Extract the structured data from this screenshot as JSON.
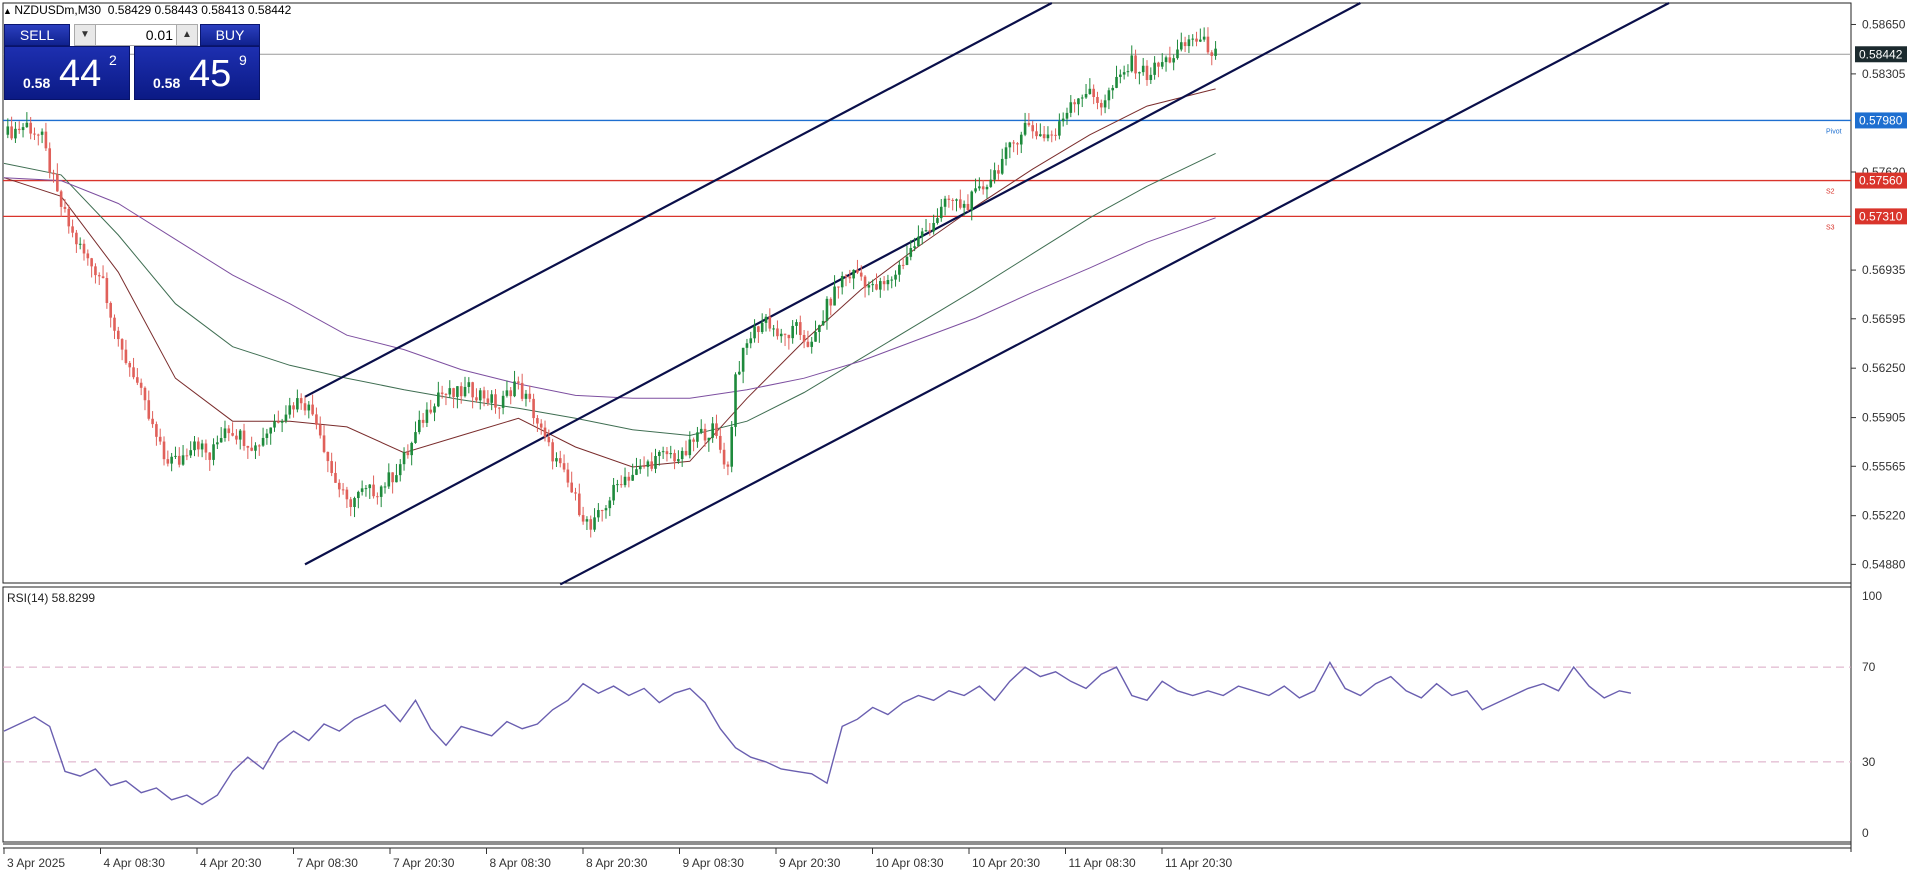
{
  "header": {
    "symbol": "NZDUSDm,M30",
    "ohlc": "0.58429 0.58443 0.58413 0.58442"
  },
  "trade_panel": {
    "sell_label": "SELL",
    "buy_label": "BUY",
    "lot_value": "0.01",
    "sell_prefix": "0.58",
    "sell_big": "44",
    "sell_sup": "2",
    "buy_prefix": "0.58",
    "buy_big": "45",
    "buy_sup": "9"
  },
  "chart_data": [
    {
      "type": "candlestick",
      "symbol": "NZDUSDm",
      "timeframe": "M30",
      "y_ticks": [
        "0.58650",
        "0.58305",
        "0.57620",
        "0.56935",
        "0.56595",
        "0.56250",
        "0.55905",
        "0.55565",
        "0.55220",
        "0.54880"
      ],
      "ylim": [
        0.5475,
        0.588
      ],
      "x_ticks": [
        "3 Apr 2025",
        "4 Apr 08:30",
        "4 Apr 20:30",
        "7 Apr 08:30",
        "7 Apr 20:30",
        "8 Apr 08:30",
        "8 Apr 20:30",
        "9 Apr 08:30",
        "9 Apr 20:30",
        "10 Apr 08:30",
        "10 Apr 20:30",
        "11 Apr 08:30",
        "11 Apr 20:30"
      ],
      "current_price": "0.58442",
      "horizontal_levels": [
        {
          "label": "Pivot",
          "price": "0.57980",
          "color": "#1e6fd0"
        },
        {
          "label": "S2",
          "price": "0.57560",
          "color": "#d9342b"
        },
        {
          "label": "S3",
          "price": "0.57310",
          "color": "#d9342b"
        }
      ],
      "close_path": [
        [
          0,
          0.5788
        ],
        [
          6,
          0.5795
        ],
        [
          10,
          0.5785
        ],
        [
          14,
          0.5745
        ],
        [
          18,
          0.5718
        ],
        [
          22,
          0.57
        ],
        [
          26,
          0.5688
        ],
        [
          30,
          0.564
        ],
        [
          34,
          0.5622
        ],
        [
          38,
          0.559
        ],
        [
          42,
          0.5562
        ],
        [
          46,
          0.556
        ],
        [
          50,
          0.5576
        ],
        [
          54,
          0.5562
        ],
        [
          58,
          0.5585
        ],
        [
          62,
          0.5578
        ],
        [
          66,
          0.557
        ],
        [
          70,
          0.5585
        ],
        [
          74,
          0.5596
        ],
        [
          78,
          0.5604
        ],
        [
          82,
          0.559
        ],
        [
          86,
          0.5552
        ],
        [
          90,
          0.553
        ],
        [
          94,
          0.5538
        ],
        [
          98,
          0.554
        ],
        [
          102,
          0.555
        ],
        [
          106,
          0.5566
        ],
        [
          110,
          0.559
        ],
        [
          114,
          0.5608
        ],
        [
          118,
          0.5606
        ],
        [
          122,
          0.561
        ],
        [
          126,
          0.5606
        ],
        [
          130,
          0.5598
        ],
        [
          134,
          0.5615
        ],
        [
          138,
          0.56
        ],
        [
          142,
          0.5574
        ],
        [
          146,
          0.5555
        ],
        [
          150,
          0.5533
        ],
        [
          154,
          0.5512
        ],
        [
          158,
          0.553
        ],
        [
          162,
          0.5548
        ],
        [
          166,
          0.5552
        ],
        [
          170,
          0.556
        ],
        [
          174,
          0.5565
        ],
        [
          178,
          0.5562
        ],
        [
          182,
          0.5578
        ],
        [
          186,
          0.5582
        ],
        [
          190,
          0.5555
        ],
        [
          192,
          0.562
        ],
        [
          196,
          0.5648
        ],
        [
          200,
          0.566
        ],
        [
          204,
          0.5645
        ],
        [
          208,
          0.5652
        ],
        [
          212,
          0.564
        ],
        [
          216,
          0.5668
        ],
        [
          220,
          0.5688
        ],
        [
          224,
          0.5692
        ],
        [
          228,
          0.568
        ],
        [
          232,
          0.5684
        ],
        [
          236,
          0.57
        ],
        [
          240,
          0.5715
        ],
        [
          244,
          0.5728
        ],
        [
          248,
          0.5742
        ],
        [
          252,
          0.5738
        ],
        [
          256,
          0.5748
        ],
        [
          260,
          0.5762
        ],
        [
          264,
          0.5778
        ],
        [
          268,
          0.5795
        ],
        [
          272,
          0.5788
        ],
        [
          276,
          0.5788
        ],
        [
          280,
          0.5812
        ],
        [
          284,
          0.5818
        ],
        [
          288,
          0.581
        ],
        [
          292,
          0.5824
        ],
        [
          296,
          0.5838
        ],
        [
          300,
          0.583
        ],
        [
          304,
          0.5838
        ],
        [
          308,
          0.5845
        ],
        [
          312,
          0.5856
        ],
        [
          316,
          0.585
        ],
        [
          318,
          0.5844
        ]
      ],
      "moving_averages": [
        {
          "color": "#7a2c2c",
          "points": [
            [
              0,
              0.5758
            ],
            [
              15,
              0.5745
            ],
            [
              30,
              0.5692
            ],
            [
              45,
              0.5618
            ],
            [
              60,
              0.5588
            ],
            [
              75,
              0.5588
            ],
            [
              90,
              0.5584
            ],
            [
              105,
              0.5566
            ],
            [
              120,
              0.5578
            ],
            [
              135,
              0.559
            ],
            [
              150,
              0.557
            ],
            [
              165,
              0.5556
            ],
            [
              180,
              0.556
            ],
            [
              195,
              0.5604
            ],
            [
              210,
              0.5644
            ],
            [
              225,
              0.568
            ],
            [
              240,
              0.571
            ],
            [
              255,
              0.5738
            ],
            [
              270,
              0.5764
            ],
            [
              285,
              0.5788
            ],
            [
              300,
              0.5808
            ],
            [
              318,
              0.582
            ]
          ]
        },
        {
          "color": "#3f6e52",
          "points": [
            [
              0,
              0.5768
            ],
            [
              15,
              0.576
            ],
            [
              30,
              0.5718
            ],
            [
              45,
              0.567
            ],
            [
              60,
              0.564
            ],
            [
              75,
              0.5627
            ],
            [
              90,
              0.5618
            ],
            [
              105,
              0.561
            ],
            [
              120,
              0.5603
            ],
            [
              135,
              0.5597
            ],
            [
              150,
              0.559
            ],
            [
              165,
              0.5582
            ],
            [
              180,
              0.5578
            ],
            [
              195,
              0.5588
            ],
            [
              210,
              0.5608
            ],
            [
              225,
              0.5632
            ],
            [
              240,
              0.5656
            ],
            [
              255,
              0.568
            ],
            [
              270,
              0.5705
            ],
            [
              285,
              0.573
            ],
            [
              300,
              0.5752
            ],
            [
              318,
              0.5775
            ]
          ]
        },
        {
          "color": "#7d4fa0",
          "points": [
            [
              0,
              0.5758
            ],
            [
              15,
              0.5756
            ],
            [
              30,
              0.574
            ],
            [
              45,
              0.5715
            ],
            [
              60,
              0.569
            ],
            [
              75,
              0.567
            ],
            [
              90,
              0.5648
            ],
            [
              105,
              0.5638
            ],
            [
              120,
              0.5624
            ],
            [
              135,
              0.5614
            ],
            [
              150,
              0.5606
            ],
            [
              165,
              0.5604
            ],
            [
              180,
              0.5604
            ],
            [
              195,
              0.561
            ],
            [
              210,
              0.5618
            ],
            [
              225,
              0.563
            ],
            [
              240,
              0.5645
            ],
            [
              255,
              0.566
            ],
            [
              270,
              0.5678
            ],
            [
              285,
              0.5695
            ],
            [
              300,
              0.5713
            ],
            [
              318,
              0.573
            ]
          ]
        }
      ],
      "trendlines": [
        {
          "from": [
            79,
            0.5605
          ],
          "to": [
            275,
            0.588
          ],
          "color": "#0a0f4a"
        },
        {
          "from": [
            79,
            0.5488
          ],
          "to": [
            356,
            0.588
          ],
          "color": "#0a0f4a"
        },
        {
          "from": [
            146,
            0.5474
          ],
          "to": [
            437,
            0.588
          ],
          "color": "#0a0f4a"
        }
      ]
    },
    {
      "type": "line",
      "title": "RSI(14) 58.8299",
      "y_ticks": [
        "100",
        "70",
        "30",
        "0"
      ],
      "ylim": [
        0,
        100
      ],
      "levels": [
        70,
        30
      ],
      "series": [
        {
          "color": "#6a5fb0",
          "points": [
            [
              0,
              43
            ],
            [
              4,
              46
            ],
            [
              8,
              49
            ],
            [
              12,
              45
            ],
            [
              16,
              26
            ],
            [
              20,
              24
            ],
            [
              24,
              27
            ],
            [
              28,
              20
            ],
            [
              32,
              22
            ],
            [
              36,
              17
            ],
            [
              40,
              19
            ],
            [
              44,
              14
            ],
            [
              48,
              16
            ],
            [
              52,
              12
            ],
            [
              56,
              16
            ],
            [
              60,
              26
            ],
            [
              64,
              32
            ],
            [
              68,
              27
            ],
            [
              72,
              38
            ],
            [
              76,
              43
            ],
            [
              80,
              39
            ],
            [
              84,
              46
            ],
            [
              88,
              43
            ],
            [
              92,
              48
            ],
            [
              96,
              51
            ],
            [
              100,
              54
            ],
            [
              104,
              47
            ],
            [
              108,
              56
            ],
            [
              112,
              44
            ],
            [
              116,
              37
            ],
            [
              120,
              45
            ],
            [
              124,
              43
            ],
            [
              128,
              41
            ],
            [
              132,
              47
            ],
            [
              136,
              44
            ],
            [
              140,
              46
            ],
            [
              144,
              52
            ],
            [
              148,
              56
            ],
            [
              152,
              63
            ],
            [
              156,
              59
            ],
            [
              160,
              62
            ],
            [
              164,
              58
            ],
            [
              168,
              61
            ],
            [
              172,
              55
            ],
            [
              176,
              59
            ],
            [
              180,
              61
            ],
            [
              184,
              55
            ],
            [
              188,
              44
            ],
            [
              192,
              36
            ],
            [
              196,
              32
            ],
            [
              200,
              30
            ],
            [
              204,
              27
            ],
            [
              208,
              26
            ],
            [
              212,
              25
            ],
            [
              216,
              21
            ],
            [
              220,
              45
            ],
            [
              224,
              48
            ],
            [
              228,
              53
            ],
            [
              232,
              50
            ],
            [
              236,
              55
            ],
            [
              240,
              58
            ],
            [
              244,
              56
            ],
            [
              248,
              60
            ],
            [
              252,
              58
            ],
            [
              256,
              62
            ],
            [
              260,
              56
            ],
            [
              264,
              64
            ],
            [
              268,
              70
            ],
            [
              272,
              66
            ],
            [
              276,
              68
            ],
            [
              280,
              64
            ],
            [
              284,
              61
            ],
            [
              288,
              67
            ],
            [
              292,
              70
            ],
            [
              296,
              58
            ],
            [
              300,
              56
            ],
            [
              304,
              64
            ],
            [
              308,
              60
            ],
            [
              312,
              58
            ],
            [
              316,
              60
            ],
            [
              320,
              58
            ],
            [
              324,
              62
            ],
            [
              328,
              60
            ],
            [
              332,
              58
            ],
            [
              336,
              62
            ],
            [
              340,
              57
            ],
            [
              344,
              60
            ],
            [
              348,
              72
            ],
            [
              352,
              61
            ],
            [
              356,
              58
            ],
            [
              360,
              63
            ],
            [
              364,
              66
            ],
            [
              368,
              60
            ],
            [
              372,
              57
            ],
            [
              376,
              63
            ],
            [
              380,
              58
            ],
            [
              384,
              60
            ],
            [
              388,
              52
            ],
            [
              392,
              55
            ],
            [
              396,
              58
            ],
            [
              400,
              61
            ],
            [
              404,
              63
            ],
            [
              408,
              60
            ],
            [
              412,
              70
            ],
            [
              416,
              62
            ],
            [
              420,
              57
            ],
            [
              424,
              60
            ],
            [
              427,
              59
            ]
          ]
        }
      ]
    }
  ]
}
